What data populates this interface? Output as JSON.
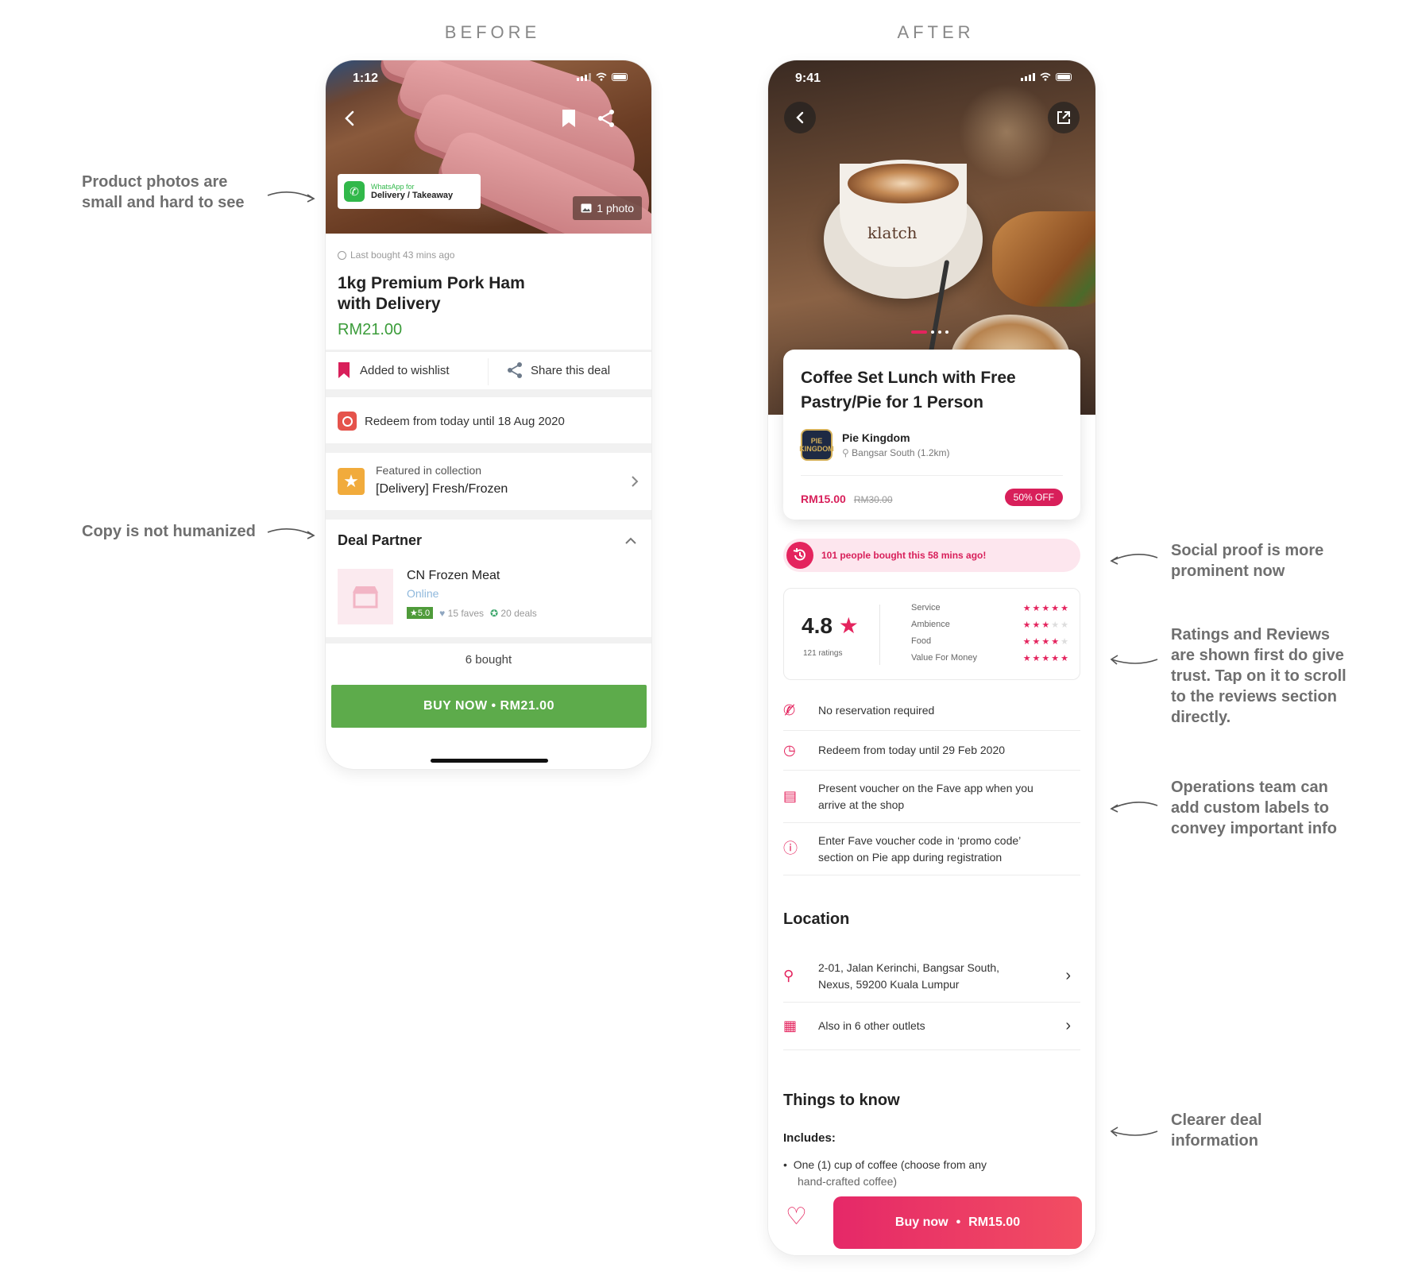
{
  "labels": {
    "before": "BEFORE",
    "after": "AFTER"
  },
  "notes": {
    "photos": [
      "Product photos are",
      "small and hard to see"
    ],
    "copy": [
      "Copy is not humanized"
    ],
    "social": [
      "Social proof is more",
      "prominent now"
    ],
    "ratings": [
      "Ratings and Reviews",
      "are shown first do give",
      "trust. Tap on it to scroll",
      "to the reviews section",
      "directly."
    ],
    "ops": [
      "Operations team can",
      "add custom labels to",
      "convey important info"
    ],
    "clearer": [
      "Clearer deal",
      "information"
    ]
  },
  "before": {
    "status_time": "1:12",
    "whatsapp_small": "WhatsApp for",
    "whatsapp_big": "Delivery / Takeaway",
    "photo_count": "1 photo",
    "last_bought": "Last bought 43 mins ago",
    "title_line1": "1kg Premium Pork Ham",
    "title_line2": "with Delivery",
    "price": "RM21.00",
    "wishlist": "Added to wishlist",
    "share": "Share this deal",
    "redeem": "Redeem from today until 18 Aug 2020",
    "featured_label": "Featured in collection",
    "featured_name": "[Delivery] Fresh/Frozen",
    "partner_heading": "Deal Partner",
    "partner_name": "CN Frozen Meat",
    "partner_status": "Online",
    "partner_rating": "5.0",
    "partner_faves": "15 faves",
    "partner_deals": "20 deals",
    "bought": "6 bought",
    "buy_button": "BUY NOW • RM21.00"
  },
  "after": {
    "status_time": "9:41",
    "cup_brand": "klatch",
    "title_line1": "Coffee Set Lunch with Free",
    "title_line2": "Pastry/Pie for 1 Person",
    "merchant_logo": "PIE KINGDOM",
    "merchant": "Pie Kingdom",
    "merchant_location": "Bangsar South (1.2km)",
    "price": "RM15.00",
    "old_price": "RM30.00",
    "discount": "50% OFF",
    "social_proof": "101 people bought this 58 mins ago!",
    "rating": "4.8",
    "rating_count": "121 ratings",
    "rating_categories": [
      {
        "name": "Service",
        "stars": 5
      },
      {
        "name": "Ambience",
        "stars": 3
      },
      {
        "name": "Food",
        "stars": 4
      },
      {
        "name": "Value For Money",
        "stars": 5
      }
    ],
    "info": {
      "reservation": "No reservation required",
      "redeem": "Redeem from today until 29 Feb 2020",
      "present_l1": "Present voucher on the Fave app when you",
      "present_l2": "arrive at the shop",
      "promo_l1": "Enter Fave voucher code in ‘promo code’",
      "promo_l2": "section on Pie app during registration"
    },
    "location_heading": "Location",
    "address_l1": "2-01, Jalan Kerinchi, Bangsar South,",
    "address_l2": "Nexus, 59200 Kuala Lumpur",
    "outlets": "Also in 6 other outlets",
    "things_heading": "Things to know",
    "includes_label": "Includes:",
    "include_l1": "One (1) cup of coffee (choose from any",
    "include_l2": "hand-crafted coffee)",
    "buy_label": "Buy now",
    "buy_price": "RM15.00"
  },
  "colors": {
    "before_accent": "#5dab4b",
    "after_accent": "#e4245e"
  },
  "icons": [
    "back-icon",
    "bookmark-icon",
    "share-icon",
    "whatsapp-icon",
    "image-icon",
    "clock-icon",
    "star-icon",
    "chevron-right-icon",
    "chevron-up-icon",
    "store-icon",
    "heart-icon",
    "external-link-icon",
    "pin-icon",
    "phone-off-icon",
    "voucher-icon",
    "info-icon",
    "history-icon"
  ]
}
